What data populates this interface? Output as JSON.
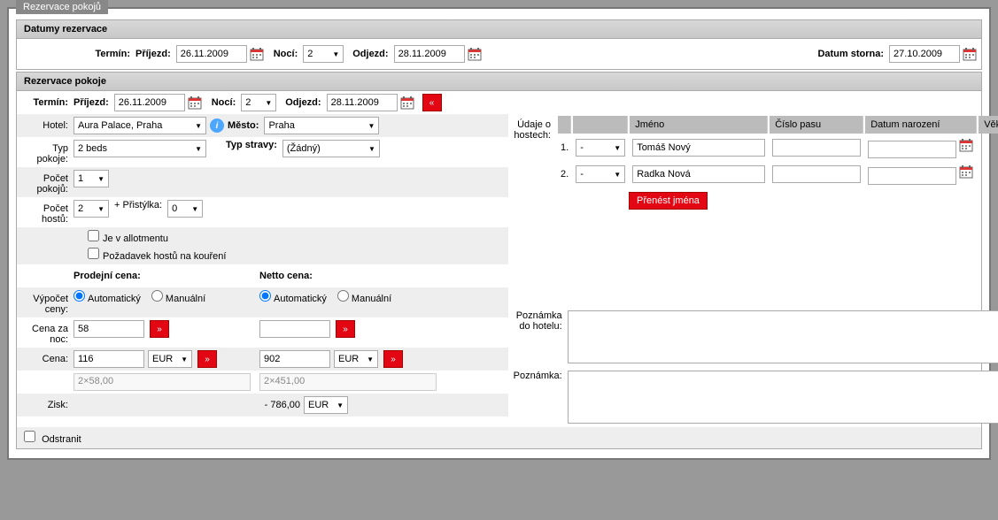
{
  "window": {
    "title": "Rezervace pokojů"
  },
  "dates_section": {
    "header": "Datumy rezervace",
    "termin_label": "Termín:",
    "prijezd_label": "Příjezd:",
    "prijezd_value": "26.11.2009",
    "noci_label": "Nocí:",
    "noci_value": "2",
    "odjezd_label": "Odjezd:",
    "odjezd_value": "28.11.2009",
    "storno_label": "Datum storna:",
    "storno_value": "27.10.2009"
  },
  "room_section": {
    "header": "Rezervace pokoje",
    "termin_label": "Termín:",
    "prijezd_label": "Příjezd:",
    "prijezd_value": "26.11.2009",
    "noci_label": "Nocí:",
    "noci_value": "2",
    "odjezd_label": "Odjezd:",
    "odjezd_value": "28.11.2009",
    "collapse_btn": "«",
    "hotel_label": "Hotel:",
    "hotel_value": "Aura Palace, Praha",
    "mesto_label": "Město:",
    "mesto_value": "Praha",
    "typ_pokoje_label": "Typ pokoje:",
    "typ_pokoje_value": "2 beds",
    "typ_stravy_label": "Typ stravy:",
    "typ_stravy_value": "(Žádný)",
    "pocet_pokoju_label": "Počet pokojů:",
    "pocet_pokoju_value": "1",
    "pocet_hostu_label": "Počet hostů:",
    "pocet_hostu_value": "2",
    "pristylka_label": "+ Přistýlka:",
    "pristylka_value": "0",
    "allotment_label": "Je v allotmentu",
    "kouren_label": "Požadavek hostů na kouření",
    "prodejni_label": "Prodejní cena:",
    "netto_label": "Netto cena:",
    "vypocet_label": "Výpočet ceny:",
    "auto_label": "Automatický",
    "manual_label": "Manuální",
    "cena_noc_label": "Cena za noc:",
    "cena_noc_value": "58",
    "netto_noc_value": "",
    "arrow_btn": "»",
    "cena_label": "Cena:",
    "cena_value": "116",
    "netto_value": "902",
    "currency": "EUR",
    "breakdown1": "2×58,00",
    "breakdown2": "2×451,00",
    "zisk_label": "Zisk:",
    "zisk_value": "- 786,00",
    "odstranit_label": "Odstranit"
  },
  "guests": {
    "header_label": "Údaje o hostech:",
    "col_jmeno": "Jméno",
    "col_pas": "Číslo pasu",
    "col_narozeni": "Datum narození",
    "col_vek": "Věk",
    "rows": [
      {
        "num": "1.",
        "sel": "-",
        "name": "Tomáš Nový",
        "pass": "",
        "birth": ""
      },
      {
        "num": "2.",
        "sel": "-",
        "name": "Radka Nová",
        "pass": "",
        "birth": ""
      }
    ],
    "transfer_btn": "Přenést jména"
  },
  "notes": {
    "hotel_label": "Poznámka do hotelu:",
    "general_label": "Poznámka:"
  }
}
